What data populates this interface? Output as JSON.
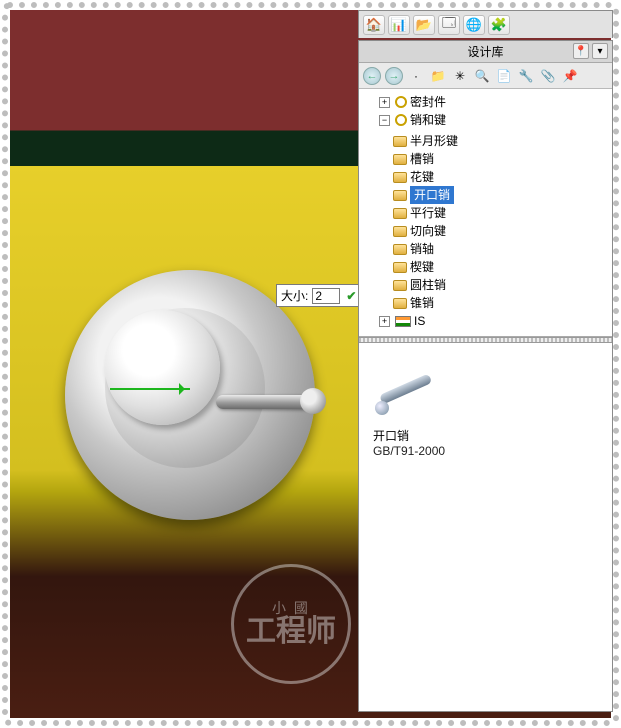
{
  "input": {
    "label": "大小:",
    "value": "2"
  },
  "top_icons": [
    "🏠",
    "📊",
    "📂",
    "🗔",
    "🌐",
    "🧩"
  ],
  "panel_title": "设计库",
  "nav_icons": [
    "←",
    "→",
    "·",
    "📁",
    "✳",
    "🔍",
    "📄",
    "🔧",
    "📎",
    "📌"
  ],
  "tree": {
    "node1": {
      "label": "密封件"
    },
    "node2": {
      "label": "销和键",
      "children": [
        "半月形键",
        "槽销",
        "花键",
        "开口销",
        "平行键",
        "切向键",
        "销轴",
        "楔键",
        "圆柱销",
        "锥销"
      ],
      "selected_index": 3
    },
    "node3": {
      "label": "IS"
    }
  },
  "preview": {
    "name": "开口销",
    "standard": "GB/T91-2000"
  },
  "watermark": {
    "top": "小 國",
    "mid": "工程师"
  }
}
